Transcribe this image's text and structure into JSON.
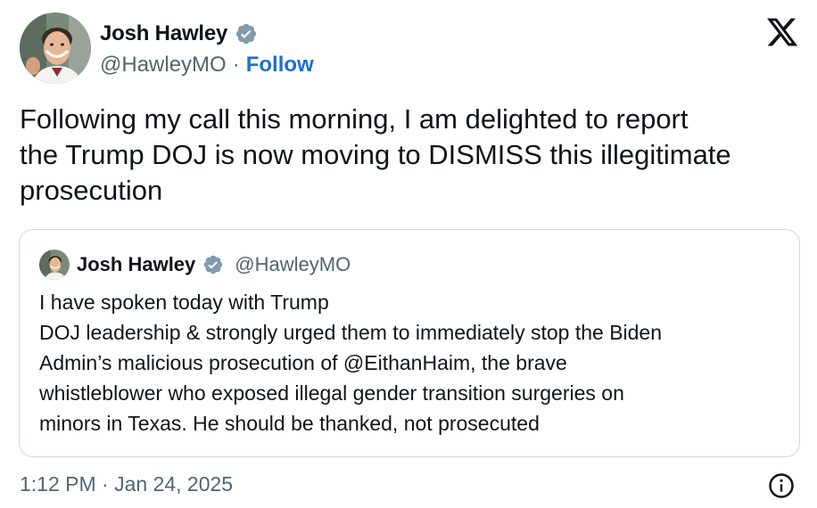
{
  "author": {
    "display_name": "Josh Hawley",
    "handle": "@HawleyMO",
    "separator": "·",
    "follow_label": "Follow",
    "verified_icon": "verified-badge-icon"
  },
  "logo_icon": "x-logo-icon",
  "tweet": {
    "lines": [
      "Following my call this morning, I am delighted to report",
      "the Trump DOJ is now moving to DISMISS this illegitimate",
      "prosecution"
    ]
  },
  "quoted_tweet": {
    "display_name": "Josh Hawley",
    "handle": "@HawleyMO",
    "lines": [
      "I have spoken today with Trump",
      "DOJ leadership & strongly urged them to immediately stop the Biden",
      "Admin’s malicious prosecution of @EithanHaim, the brave",
      "whistleblower who exposed illegal gender transition surgeries on",
      "minors in Texas.  He should be thanked, not prosecuted"
    ]
  },
  "footer": {
    "timestamp": "1:12 PM · Jan 24, 2025",
    "info_icon": "info-icon"
  },
  "colors": {
    "text": "#0f1419",
    "secondary": "#536471",
    "follow": "#1d6fd1",
    "verified": "#829aab",
    "border": "#cfd9de"
  }
}
